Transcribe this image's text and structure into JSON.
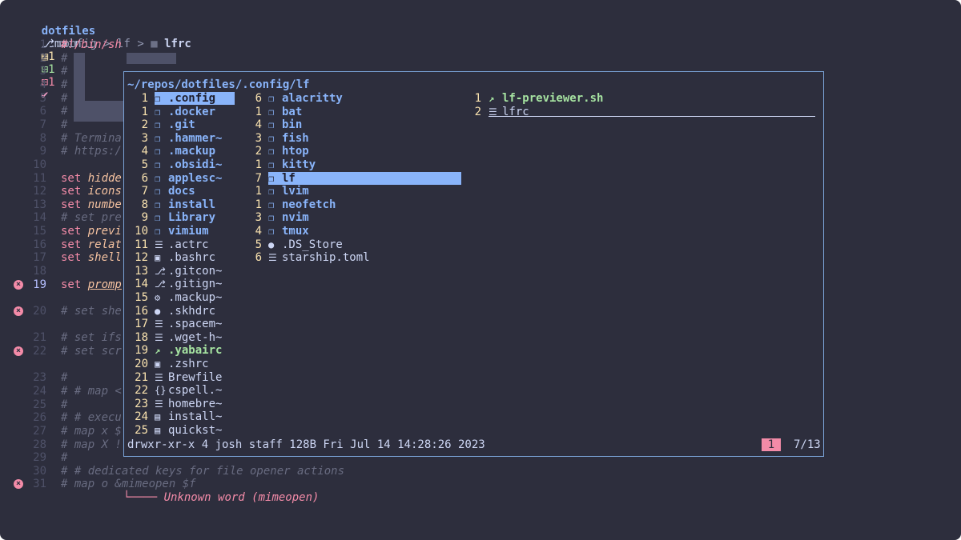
{
  "header": {
    "repo": "dotfiles",
    "branch_icon": "git-branch-icon",
    "branch": "main",
    "modified_count": "1",
    "added_count": "1",
    "deleted_count": "1",
    "breadcrumb": [
      ".config",
      "lf",
      "lfrc"
    ],
    "breadcrumb_sep": ">"
  },
  "editor": {
    "lines": [
      {
        "n": "1",
        "text": "#!/bin/sh"
      },
      {
        "n": "2",
        "text": "#"
      },
      {
        "n": "3",
        "text": "#"
      },
      {
        "n": "4",
        "text": "#"
      },
      {
        "n": "5",
        "text": "#"
      },
      {
        "n": "6",
        "text": "#"
      },
      {
        "n": "7",
        "text": "#"
      },
      {
        "n": "8",
        "text": "# Termina"
      },
      {
        "n": "9",
        "text": "# https:/"
      },
      {
        "n": "10",
        "text": ""
      },
      {
        "n": "11",
        "kw": "set",
        "var": "hidde"
      },
      {
        "n": "12",
        "kw": "set",
        "var": "icons"
      },
      {
        "n": "13",
        "kw": "set",
        "var": "numbe"
      },
      {
        "n": "14",
        "text": "# set pre"
      },
      {
        "n": "15",
        "kw": "set",
        "var": "previ"
      },
      {
        "n": "16",
        "kw": "set",
        "var": "relat"
      },
      {
        "n": "17",
        "kw": "set",
        "var": "shell"
      },
      {
        "n": "18",
        "text": ""
      },
      {
        "n": "19",
        "kw": "set",
        "var": "promp",
        "current": true,
        "error": true
      },
      {
        "n": "",
        "text": ""
      },
      {
        "n": "20",
        "text": "# set she",
        "error": true
      },
      {
        "n": "",
        "text": ""
      },
      {
        "n": "21",
        "text": "# set ifs"
      },
      {
        "n": "22",
        "text": "# set scr",
        "error": true
      },
      {
        "n": "",
        "text": ""
      },
      {
        "n": "23",
        "text": "#"
      },
      {
        "n": "24",
        "text": "# # map <"
      },
      {
        "n": "25",
        "text": "#"
      },
      {
        "n": "26",
        "text": "# # execu"
      },
      {
        "n": "27",
        "text": "# map x $"
      },
      {
        "n": "28",
        "text": "# map X !"
      },
      {
        "n": "29",
        "text": "#"
      },
      {
        "n": "30",
        "text": "# # dedicated keys for file opener actions"
      },
      {
        "n": "31",
        "text": "# map o &mimeopen $f",
        "error": true
      }
    ],
    "diagnostic": "Unknown word (mimeopen)",
    "error_icon": "error-icon"
  },
  "lf": {
    "path": "~/repos/dotfiles/.config/lf",
    "col1": [
      {
        "c": "1",
        "name": ".config",
        "type": "dir",
        "sel": true
      },
      {
        "c": "1",
        "name": ".docker",
        "type": "dir"
      },
      {
        "c": "2",
        "name": ".git",
        "type": "dir"
      },
      {
        "c": "3",
        "name": ".hammer~",
        "type": "dir"
      },
      {
        "c": "4",
        "name": ".mackup",
        "type": "dir"
      },
      {
        "c": "5",
        "name": ".obsidi~",
        "type": "dir"
      },
      {
        "c": "6",
        "name": "applesc~",
        "type": "dir"
      },
      {
        "c": "7",
        "name": "docs",
        "type": "dir"
      },
      {
        "c": "8",
        "name": "install",
        "type": "dir"
      },
      {
        "c": "9",
        "name": "Library",
        "type": "dir"
      },
      {
        "c": "10",
        "name": "vimium",
        "type": "dir"
      },
      {
        "c": "11",
        "name": ".actrc",
        "type": "file",
        "icon": "file"
      },
      {
        "c": "12",
        "name": ".bashrc",
        "type": "file",
        "icon": "terminal"
      },
      {
        "c": "13",
        "name": ".gitcon~",
        "type": "file",
        "icon": "git"
      },
      {
        "c": "14",
        "name": ".gitign~",
        "type": "file",
        "icon": "git"
      },
      {
        "c": "15",
        "name": ".mackup~",
        "type": "file",
        "icon": "gear"
      },
      {
        "c": "16",
        "name": ".skhdrc",
        "type": "file",
        "icon": "apple"
      },
      {
        "c": "17",
        "name": ".spacem~",
        "type": "file",
        "icon": "file"
      },
      {
        "c": "18",
        "name": ".wget-h~",
        "type": "file",
        "icon": "file"
      },
      {
        "c": "19",
        "name": ".yabairc",
        "type": "exe",
        "icon": "rocket"
      },
      {
        "c": "20",
        "name": ".zshrc",
        "type": "file",
        "icon": "terminal"
      },
      {
        "c": "21",
        "name": "Brewfile",
        "type": "file",
        "icon": "file"
      },
      {
        "c": "22",
        "name": "cspell.~",
        "type": "file",
        "icon": "json"
      },
      {
        "c": "23",
        "name": "homebre~",
        "type": "file",
        "icon": "file"
      },
      {
        "c": "24",
        "name": "install~",
        "type": "file",
        "icon": "script"
      },
      {
        "c": "25",
        "name": "quickst~",
        "type": "file",
        "icon": "script"
      }
    ],
    "col2": [
      {
        "c": "6",
        "name": "alacritty",
        "type": "dir"
      },
      {
        "c": "1",
        "name": "bat",
        "type": "dir"
      },
      {
        "c": "4",
        "name": "bin",
        "type": "dir"
      },
      {
        "c": "3",
        "name": "fish",
        "type": "dir"
      },
      {
        "c": "2",
        "name": "htop",
        "type": "dir"
      },
      {
        "c": "1",
        "name": "kitty",
        "type": "dir"
      },
      {
        "c": "7",
        "name": "lf",
        "type": "dir",
        "sel": true
      },
      {
        "c": "1",
        "name": "lvim",
        "type": "dir"
      },
      {
        "c": "1",
        "name": "neofetch",
        "type": "dir"
      },
      {
        "c": "3",
        "name": "nvim",
        "type": "dir"
      },
      {
        "c": "4",
        "name": "tmux",
        "type": "dir"
      },
      {
        "c": "5",
        "name": ".DS_Store",
        "type": "file",
        "icon": "apple"
      },
      {
        "c": "6",
        "name": "starship.toml",
        "type": "file",
        "icon": "file"
      }
    ],
    "col3": [
      {
        "c": "1",
        "name": "lf-previewer.sh",
        "type": "exe",
        "icon": "rocket"
      },
      {
        "c": "2",
        "name": "lfrc",
        "type": "file",
        "icon": "file",
        "underline": true
      }
    ],
    "status": "drwxr-xr-x 4 josh staff 128B Fri Jul 14 14:28:26 2023",
    "badge": "1",
    "position": "7/13"
  },
  "colors": {
    "bg": "#2d2e3d",
    "dir": "#89b4fa",
    "count": "#f9e2af",
    "exe": "#a6e3a1",
    "error": "#f38ba8",
    "border": "#7aa2d6"
  }
}
